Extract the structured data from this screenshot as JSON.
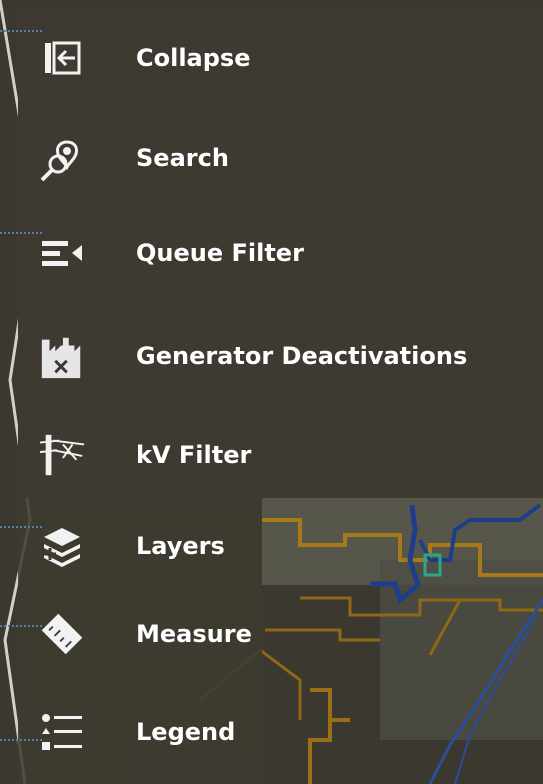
{
  "menu": {
    "items": [
      {
        "label": "Collapse",
        "icon": "collapse-icon"
      },
      {
        "label": "Search",
        "icon": "search-pin-icon"
      },
      {
        "label": "Queue Filter",
        "icon": "queue-filter-icon"
      },
      {
        "label": "Generator Deactivations",
        "icon": "factory-x-icon"
      },
      {
        "label": "kV Filter",
        "icon": "transmission-tower-icon"
      },
      {
        "label": "Layers",
        "icon": "layers-icon"
      },
      {
        "label": "Measure",
        "icon": "ruler-icon"
      },
      {
        "label": "Legend",
        "icon": "legend-list-icon"
      }
    ]
  },
  "colors": {
    "panel_bg": "#3e3a31",
    "text": "#ffffff",
    "map_orange": "#b5801d",
    "map_blue": "#1e3f8c",
    "pointer_dots": "#5a7ca4"
  }
}
